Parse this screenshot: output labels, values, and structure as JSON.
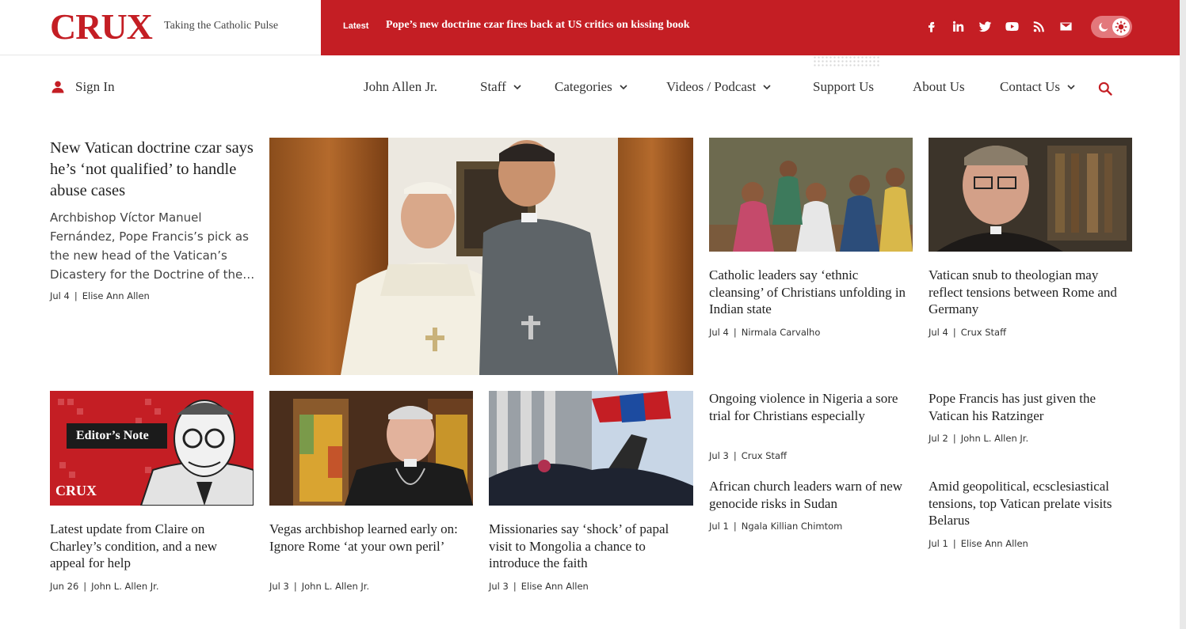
{
  "brand": {
    "logo": "CRUX",
    "tagline": "Taking the Catholic Pulse"
  },
  "latest": {
    "label": "Latest",
    "headline": "Pope’s new doctrine czar fires back at US critics on kissing book"
  },
  "social_icons": [
    "facebook-icon",
    "linkedin-icon",
    "twitter-icon",
    "youtube-icon",
    "rss-icon",
    "mail-icon"
  ],
  "theme_toggle": {
    "icons": [
      "moon-icon",
      "sun-icon"
    ]
  },
  "nav": {
    "sign_in": "Sign In",
    "items": [
      {
        "label": "John Allen Jr.",
        "dropdown": false
      },
      {
        "label": "Staff",
        "dropdown": true
      },
      {
        "label": "Categories",
        "dropdown": true
      },
      {
        "label": "Videos / Podcast",
        "dropdown": true
      },
      {
        "label": "Support Us",
        "dropdown": false
      },
      {
        "label": "About Us",
        "dropdown": false
      },
      {
        "label": "Contact Us",
        "dropdown": true
      }
    ]
  },
  "lead": {
    "title": "New Vatican doctrine czar says he’s ‘not qualified’ to handle abuse cases",
    "excerpt": "Archbishop Víctor Manuel Fernández, Pope Francis’s pick as the new head of the Vatican’s Dicastery for the Doctrine of the…",
    "date": "Jul 4",
    "author": "Elise Ann Allen"
  },
  "stories": [
    {
      "title": "Catholic leaders say ‘ethnic cleansing’ of Christians unfolding in Indian state",
      "date": "Jul 4",
      "author": "Nirmala Carvalho"
    },
    {
      "title": "Vatican snub to theologian may reflect tensions between Rome and Germany",
      "date": "Jul 4",
      "author": "Crux Staff"
    },
    {
      "title": "Latest update from Claire on Charley’s condition, and a new appeal for help",
      "date": "Jun 26",
      "author": "John L. Allen Jr."
    },
    {
      "title": "Vegas archbishop learned early on: Ignore Rome ‘at your own peril’",
      "date": "Jul 3",
      "author": "John L. Allen Jr."
    },
    {
      "title": "Missionaries say ‘shock’ of papal visit to Mongolia a chance to introduce the faith",
      "date": "Jul 3",
      "author": "Elise Ann Allen"
    },
    {
      "title": "Ongoing violence in Nigeria a sore trial for Christians especially",
      "date": "Jul 3",
      "author": "Crux Staff"
    },
    {
      "title": "Pope Francis has just given the Vatican his Ratzinger",
      "date": "Jul 2",
      "author": "John L. Allen Jr."
    },
    {
      "title": "African church leaders warn of new genocide risks in Sudan",
      "date": "Jul 1",
      "author": "Ngala Killian Chimtom"
    },
    {
      "title": "Amid geopolitical, ecsclesiastical tensions, top Vatican prelate visits Belarus",
      "date": "Jul 1",
      "author": "Elise Ann Allen"
    }
  ],
  "editor_note": {
    "label": "Editor’s Note",
    "brand": "CRUX"
  },
  "colors": {
    "brand_red": "#c41e24",
    "text": "#222222"
  }
}
